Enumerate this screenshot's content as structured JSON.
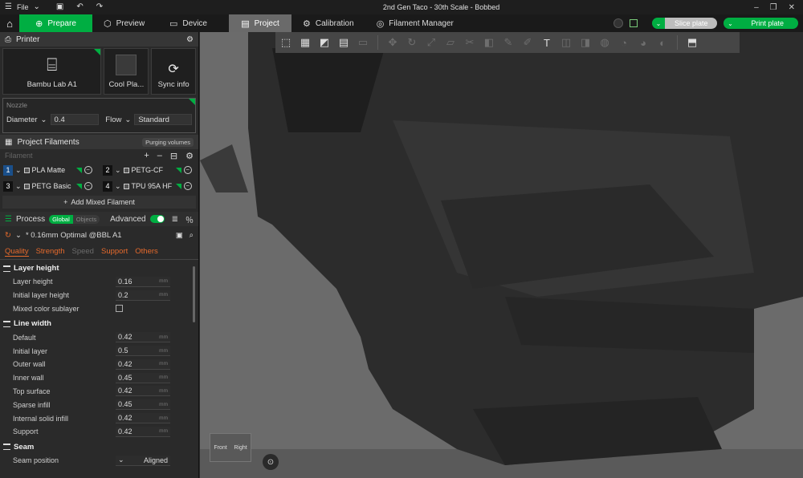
{
  "titlebar": {
    "file_menu": "File",
    "title": "2nd Gen Taco - 30th Scale - Bobbed"
  },
  "nav": {
    "tabs": [
      {
        "label": "Prepare",
        "icon": "plus-circle-icon"
      },
      {
        "label": "Preview",
        "icon": "cube-icon"
      },
      {
        "label": "Device",
        "icon": "monitor-icon"
      },
      {
        "label": "Project",
        "icon": "folder-icon"
      },
      {
        "label": "Calibration",
        "icon": "gear-icon"
      },
      {
        "label": "Filament Manager",
        "icon": "globe-icon"
      }
    ],
    "slice_label": "Slice plate",
    "print_label": "Print plate"
  },
  "printer": {
    "section_title": "Printer",
    "printer_name": "Bambu Lab A1",
    "plate_name": "Cool Pla...",
    "sync_label": "Sync info"
  },
  "nozzle": {
    "title": "Nozzle",
    "diameter_label": "Diameter",
    "diameter_value": "0.4",
    "flow_label": "Flow",
    "flow_value": "Standard"
  },
  "filaments": {
    "section_title": "Project Filaments",
    "purge_label": "Purging volumes",
    "filter_placeholder": "Filament",
    "items": [
      {
        "num": "1",
        "name": "PLA Matte"
      },
      {
        "num": "2",
        "name": "PETG-CF"
      },
      {
        "num": "3",
        "name": "PETG Basic"
      },
      {
        "num": "4",
        "name": "TPU 95A HF"
      }
    ],
    "add_mixed_label": "Add Mixed Filament"
  },
  "process": {
    "title": "Process",
    "global_label": "Global",
    "objects_label": "Objects",
    "advanced_label": "Advanced",
    "preset": "* 0.16mm Optimal @BBL A1",
    "tabs": [
      "Quality",
      "Strength",
      "Speed",
      "Support",
      "Others"
    ]
  },
  "settings": {
    "layer_height_group": "Layer height",
    "layer_height_rows": [
      {
        "label": "Layer height",
        "value": "0.16",
        "unit": "mm"
      },
      {
        "label": "Initial layer height",
        "value": "0.2",
        "unit": "mm"
      }
    ],
    "mixed_label": "Mixed color sublayer",
    "line_width_group": "Line width",
    "line_width_rows": [
      {
        "label": "Default",
        "value": "0.42",
        "unit": "mm"
      },
      {
        "label": "Initial layer",
        "value": "0.5",
        "unit": "mm"
      },
      {
        "label": "Outer wall",
        "value": "0.42",
        "unit": "mm"
      },
      {
        "label": "Inner wall",
        "value": "0.45",
        "unit": "mm"
      },
      {
        "label": "Top surface",
        "value": "0.42",
        "unit": "mm"
      },
      {
        "label": "Sparse infill",
        "value": "0.45",
        "unit": "mm"
      },
      {
        "label": "Internal solid infill",
        "value": "0.42",
        "unit": "mm"
      },
      {
        "label": "Support",
        "value": "0.42",
        "unit": "mm"
      }
    ],
    "seam_group": "Seam",
    "seam_position_label": "Seam position",
    "seam_position_value": "Aligned"
  },
  "viewport": {
    "cube_front": "Front",
    "cube_right": "Right"
  },
  "colors": {
    "accent": "#00ae42",
    "tab_orange": "#e66a2c"
  }
}
